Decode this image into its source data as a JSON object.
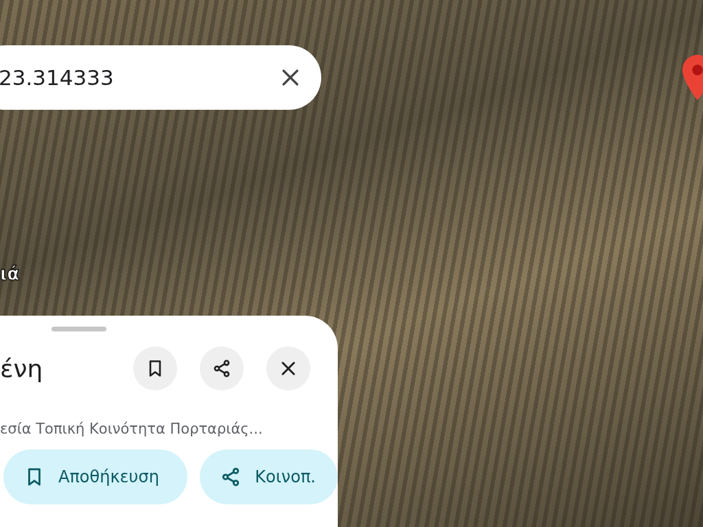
{
  "search": {
    "value": "23.314333"
  },
  "map": {
    "place_label": "ιά"
  },
  "place": {
    "title": "ένη",
    "address": "εσία Τοπική Κοινότητα Πορταριάς...",
    "header_buttons": [
      {
        "kind": "save"
      },
      {
        "kind": "share"
      },
      {
        "kind": "close"
      }
    ],
    "actions": [
      {
        "kind": "save",
        "label": "Αποθήκευση"
      },
      {
        "kind": "share",
        "label": "Κοινοπ."
      }
    ]
  }
}
